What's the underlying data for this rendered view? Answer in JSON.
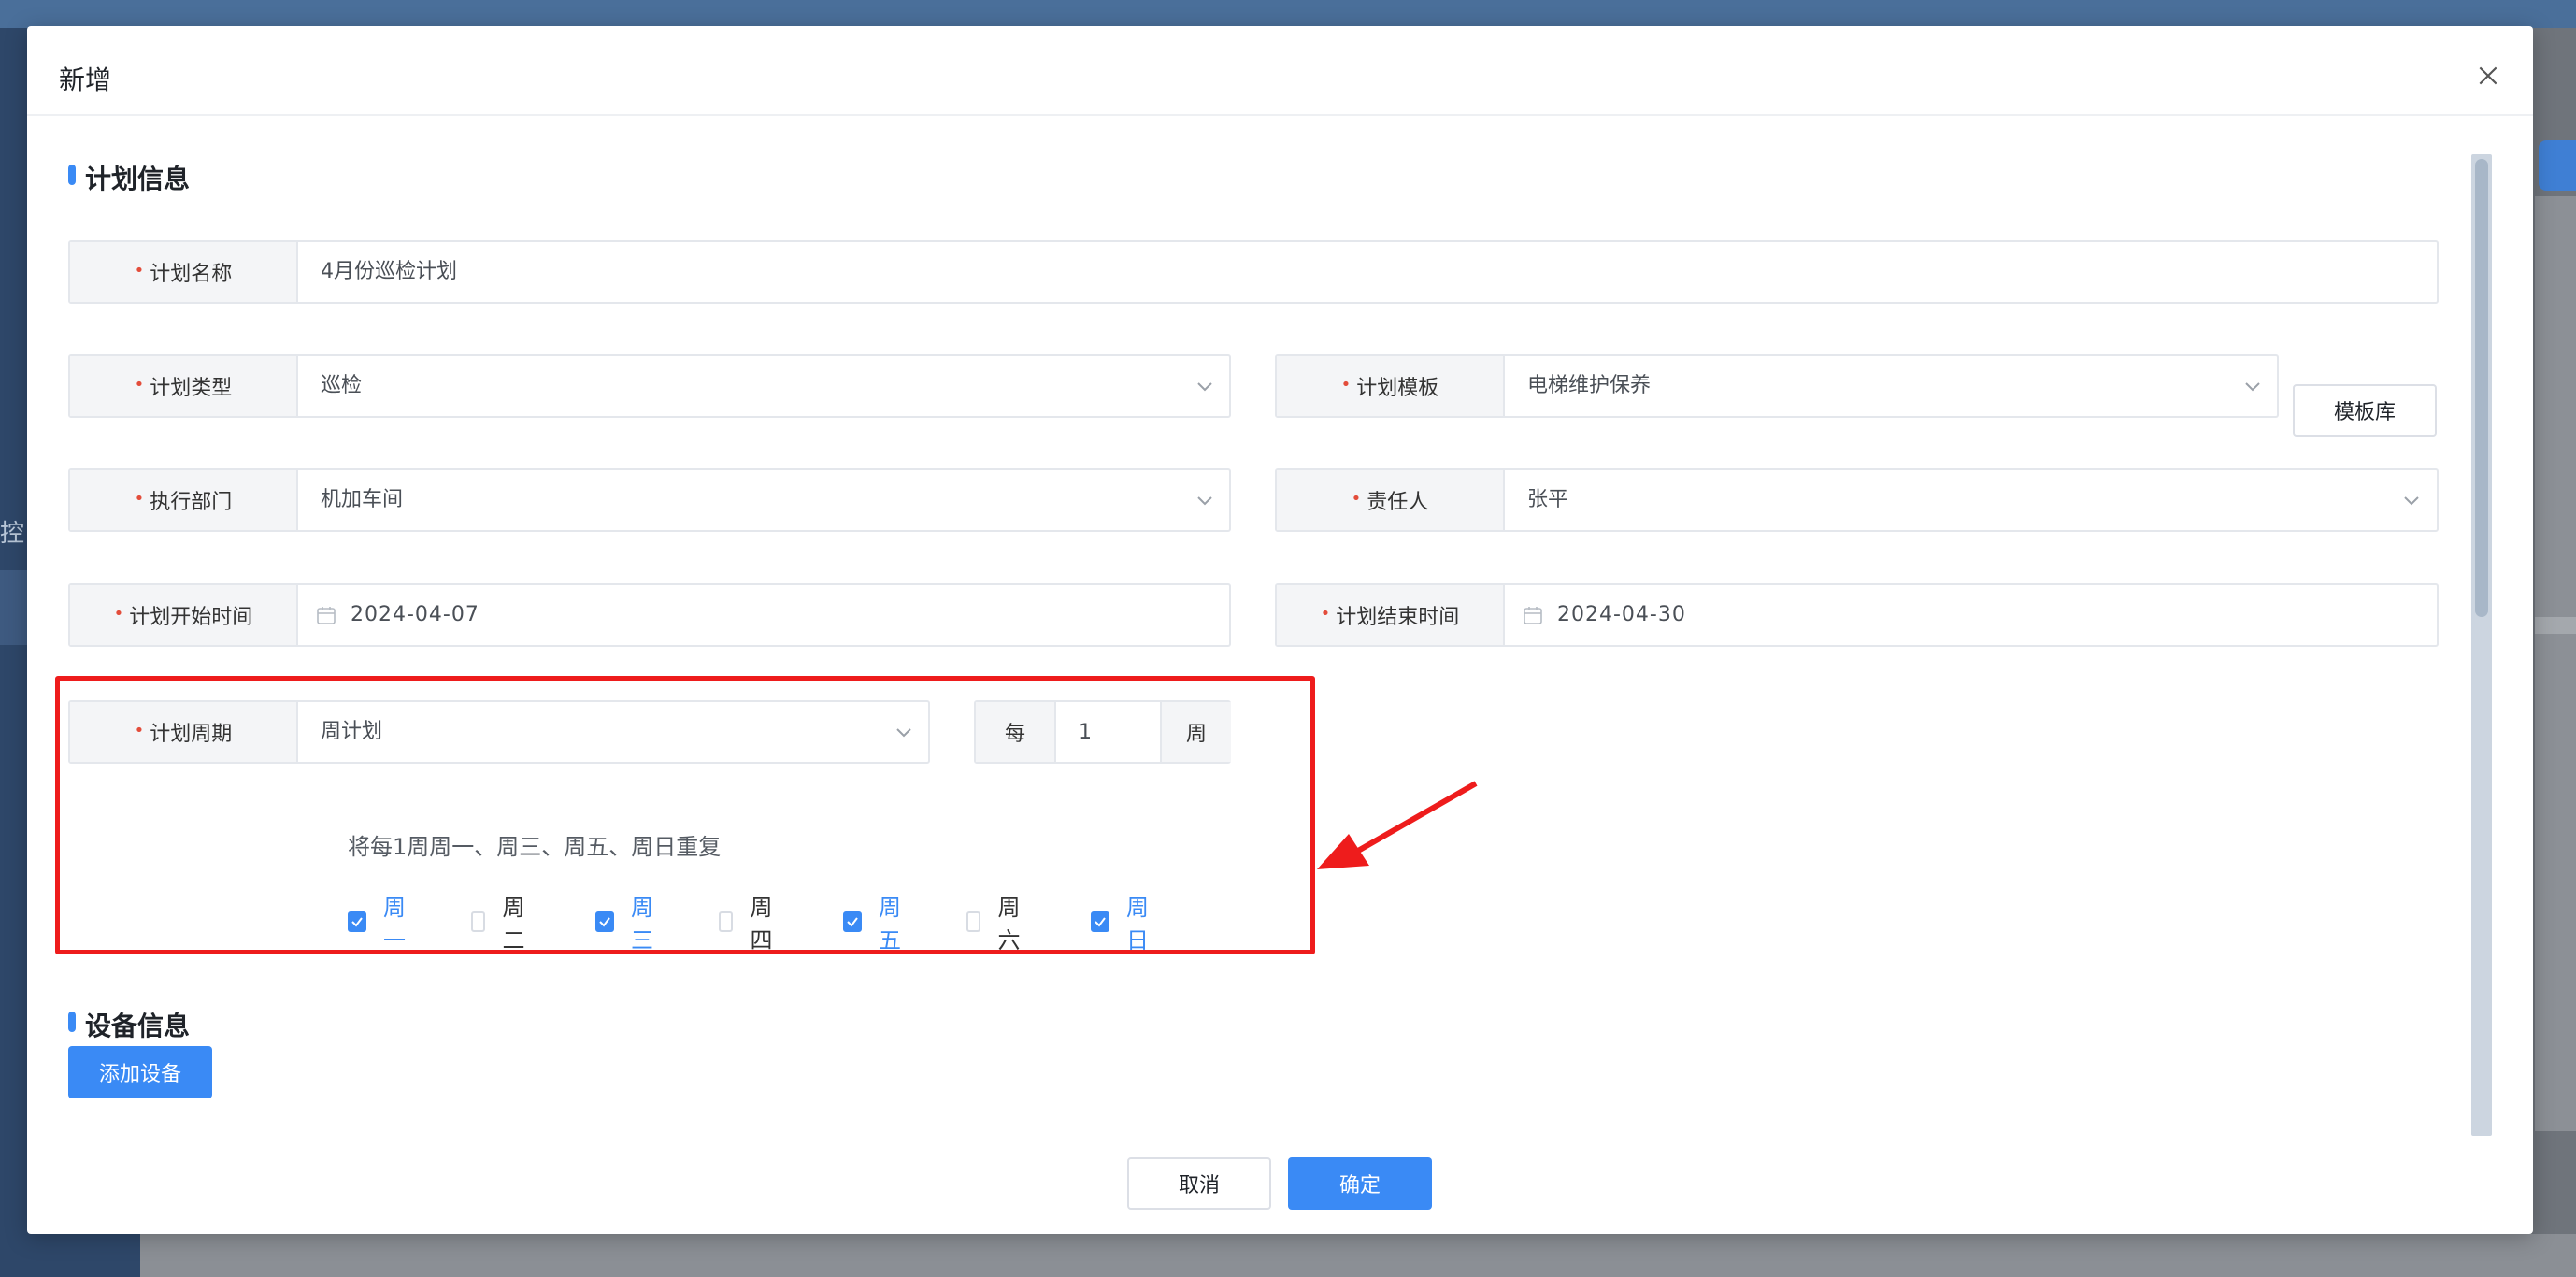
{
  "background": {
    "side_text": "控"
  },
  "modal": {
    "title": "新增",
    "sections": {
      "plan_info": "计划信息",
      "device_info": "设备信息"
    },
    "fields": {
      "plan_name": {
        "label": "计划名称",
        "value": "4月份巡检计划"
      },
      "plan_type": {
        "label": "计划类型",
        "value": "巡检"
      },
      "plan_template": {
        "label": "计划模板",
        "value": "电梯维护保养"
      },
      "exec_dept": {
        "label": "执行部门",
        "value": "机加车间"
      },
      "owner": {
        "label": "责任人",
        "value": "张平"
      },
      "start_time": {
        "label": "计划开始时间",
        "value": "2024-04-07"
      },
      "end_time": {
        "label": "计划结束时间",
        "value": "2024-04-30"
      },
      "plan_cycle": {
        "label": "计划周期",
        "value": "周计划"
      }
    },
    "every": {
      "prefix": "每",
      "value": "1",
      "unit": "周"
    },
    "template_library_label": "模板库",
    "repeat_summary": "将每1周周一、周三、周五、周日重复",
    "weekdays": [
      {
        "label": "周一",
        "checked": true
      },
      {
        "label": "周二",
        "checked": false
      },
      {
        "label": "周三",
        "checked": true
      },
      {
        "label": "周四",
        "checked": false
      },
      {
        "label": "周五",
        "checked": true
      },
      {
        "label": "周六",
        "checked": false
      },
      {
        "label": "周日",
        "checked": true
      }
    ],
    "add_device_label": "添加设备",
    "footer": {
      "cancel_label": "取消",
      "ok_label": "确定"
    }
  },
  "colors": {
    "accent": "#3a8af5",
    "required": "#e34d3b",
    "highlight": "#ee1c1c"
  },
  "icons": [
    "close-icon",
    "chevron-down-icon",
    "calendar-icon",
    "check-icon",
    "arrow-annotation"
  ]
}
